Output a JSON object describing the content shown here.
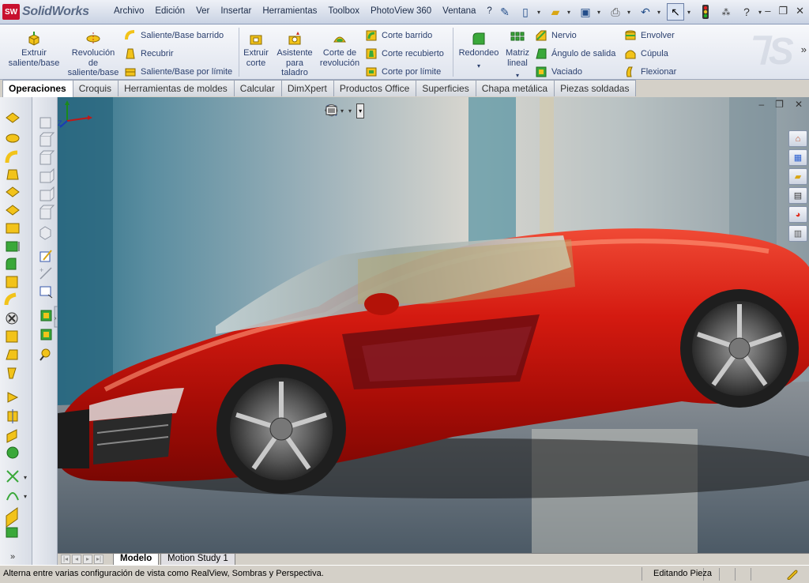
{
  "app": {
    "brand": "SolidWorks",
    "logo_mark": "SW"
  },
  "menu": [
    "Archivo",
    "Edición",
    "Ver",
    "Insertar",
    "Herramientas",
    "Toolbox",
    "PhotoView 360",
    "Ventana",
    "?"
  ],
  "command_manager": {
    "big_buttons": [
      {
        "label": "Extruir saliente/base",
        "icon": "extrude-boss-icon"
      },
      {
        "label": "Revolución de saliente/base",
        "icon": "revolve-boss-icon"
      },
      {
        "label": "Extruir corte",
        "icon": "extrude-cut-icon"
      },
      {
        "label": "Asistente para taladro",
        "icon": "hole-wizard-icon"
      },
      {
        "label": "Corte de revolución",
        "icon": "revolve-cut-icon"
      },
      {
        "label": "Redondeo",
        "icon": "fillet-icon"
      },
      {
        "label": "Matriz lineal",
        "icon": "linear-pattern-icon"
      }
    ],
    "small_buttons": [
      {
        "label": "Saliente/Base barrido",
        "icon": "swept-boss-icon"
      },
      {
        "label": "Recubrir",
        "icon": "loft-icon"
      },
      {
        "label": "Saliente/Base por límite",
        "icon": "boundary-boss-icon"
      },
      {
        "label": "Corte barrido",
        "icon": "swept-cut-icon"
      },
      {
        "label": "Corte recubierto",
        "icon": "lofted-cut-icon"
      },
      {
        "label": "Corte por límite",
        "icon": "boundary-cut-icon"
      },
      {
        "label": "Nervio",
        "icon": "rib-icon"
      },
      {
        "label": "Ángulo de salida",
        "icon": "draft-icon"
      },
      {
        "label": "Vaciado",
        "icon": "shell-icon"
      },
      {
        "label": "Envolver",
        "icon": "wrap-icon"
      },
      {
        "label": "Cúpula",
        "icon": "dome-icon"
      },
      {
        "label": "Flexionar",
        "icon": "flex-icon"
      }
    ]
  },
  "tabs": [
    {
      "label": "Operaciones",
      "active": true
    },
    {
      "label": "Croquis"
    },
    {
      "label": "Herramientas de moldes"
    },
    {
      "label": "Calcular"
    },
    {
      "label": "DimXpert"
    },
    {
      "label": "Productos Office"
    },
    {
      "label": "Superficies"
    },
    {
      "label": "Chapa metálica"
    },
    {
      "label": "Piezas soldadas"
    }
  ],
  "viewport": {
    "triad_axes": [
      "Z",
      "X",
      "Y"
    ]
  },
  "bottom_tabs": [
    {
      "label": "Modelo",
      "active": true
    },
    {
      "label": "Motion Study 1"
    }
  ],
  "status": {
    "message": "Alterna entre varias configuración de vista como RealView, Sombras y Perspectiva.",
    "mode": "Editando Pieza"
  },
  "colors": {
    "car_red": "#d41a10",
    "accent_blue": "#244e8a",
    "icon_yellow": "#f2c31a",
    "icon_green": "#3aa83a"
  }
}
